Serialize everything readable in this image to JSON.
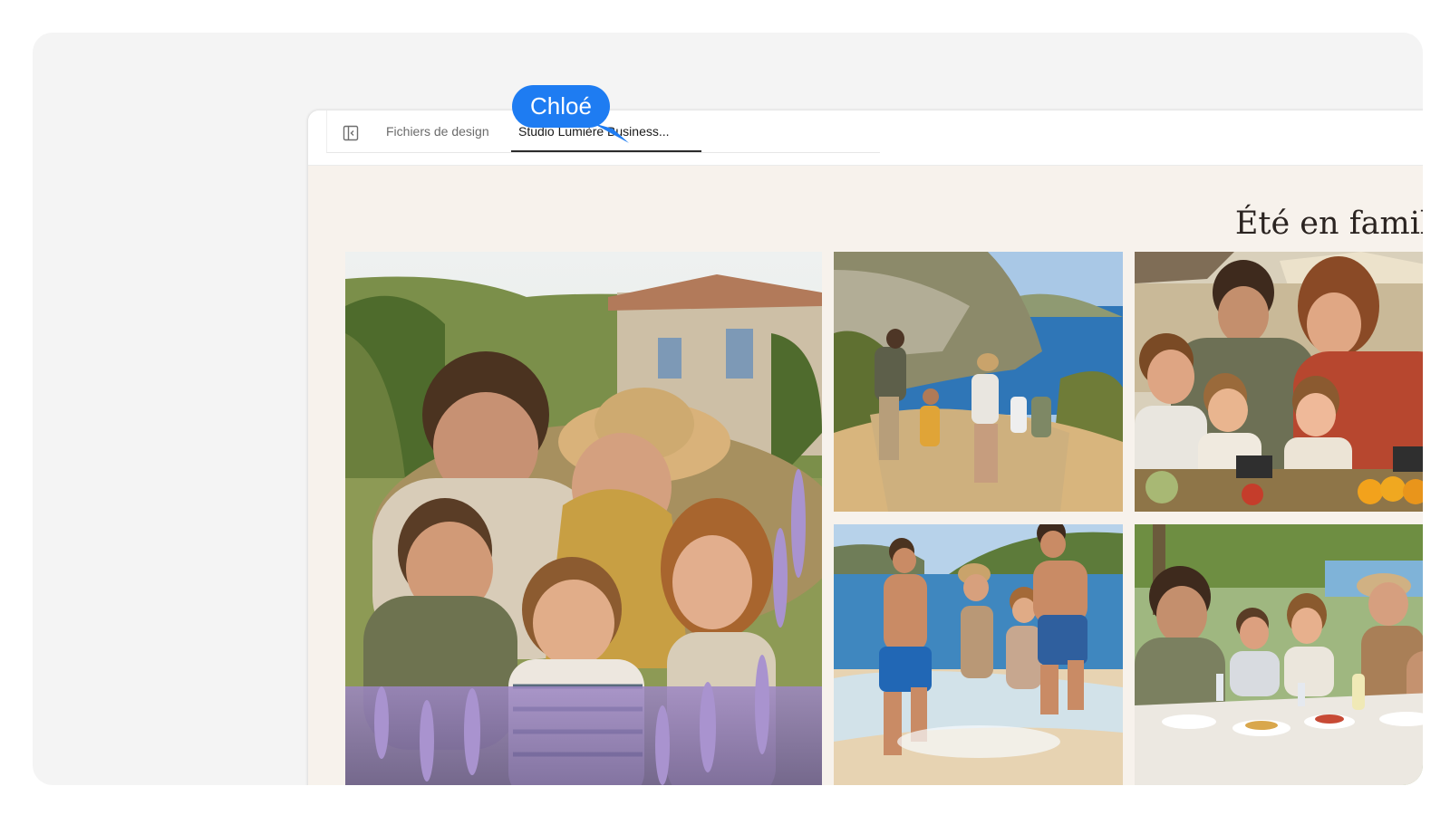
{
  "tabs": {
    "design_files_label": "Fichiers de design",
    "active_label": "Studio Lumière Business..."
  },
  "album": {
    "title": "Été en famille"
  },
  "collaborator": {
    "name": "Chloé",
    "color": "#1e7cf2"
  },
  "icons": {
    "sidebar_toggle": "sidebar-toggle-icon"
  },
  "photos": [
    {
      "name": "family-lavender-photo"
    },
    {
      "name": "coastal-hike-photo"
    },
    {
      "name": "market-photo"
    },
    {
      "name": "beach-run-photo"
    },
    {
      "name": "outdoor-dinner-photo"
    }
  ],
  "colors": {
    "canvas_background": "#f7f2ec",
    "outer_background": "#f4f4f4"
  }
}
